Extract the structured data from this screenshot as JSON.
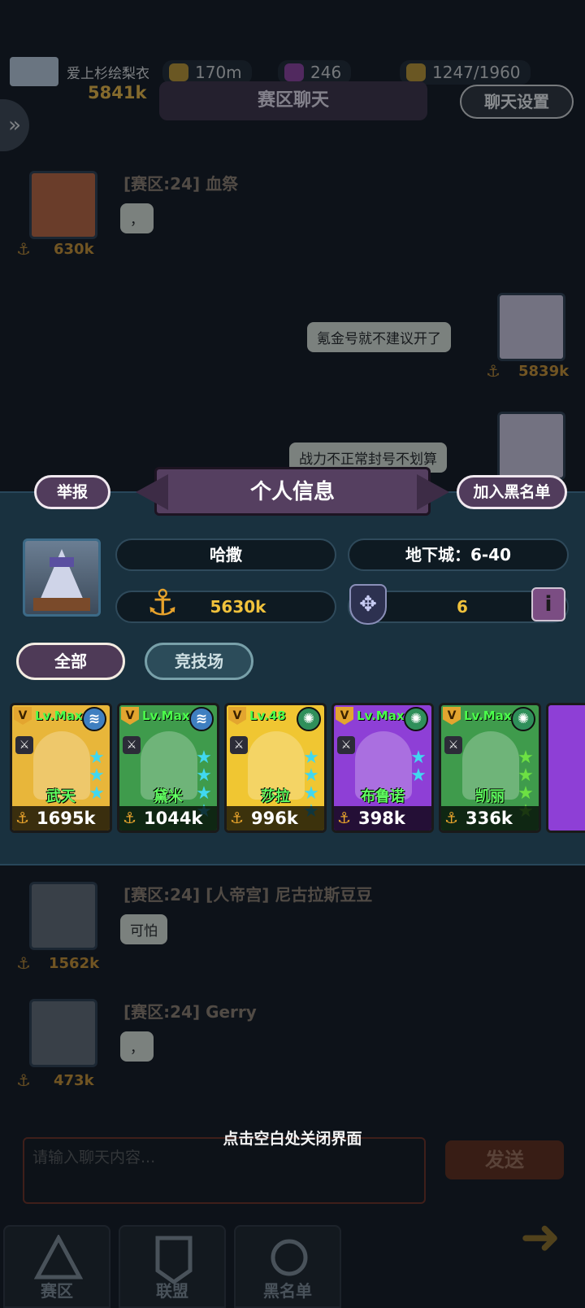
{
  "topbar": {
    "player_name": "爱上杉绘梨衣",
    "player_power": "5841k",
    "gold": "170m",
    "gems": "246",
    "energy": "1247/1960"
  },
  "chat": {
    "title": "赛区聊天",
    "settings_label": "聊天设置",
    "messages_top": [
      {
        "sender": "[赛区:24] 血祭",
        "text": "，",
        "power": "630k"
      },
      {
        "text": "氪金号就不建议开了",
        "power": "5839k"
      },
      {
        "text": "战力不正常封号不划算"
      }
    ],
    "messages_bottom": [
      {
        "sender": "[赛区:24] [人帝宫] 尼古拉斯豆豆",
        "text": "可怕",
        "power": "1562k"
      },
      {
        "sender": "[赛区:24] Gerry",
        "text": "，",
        "power": "473k"
      }
    ],
    "input_placeholder": "请输入聊天内容...",
    "send_label": "发送",
    "close_hint": "点击空白处关闭界面"
  },
  "bottom_tabs": [
    {
      "label": "赛区"
    },
    {
      "label": "联盟"
    },
    {
      "label": "黑名单"
    }
  ],
  "info_panel": {
    "title": "个人信息",
    "report_label": "举报",
    "blacklist_label": "加入黑名单",
    "player_name": "哈撒",
    "dungeon": "地下城：6-40",
    "power": "5630k",
    "rank": "6",
    "tabs": [
      {
        "label": "全部",
        "active": true
      },
      {
        "label": "竞技场",
        "active": false
      }
    ],
    "heroes": [
      {
        "name": "武天",
        "level": "Lv.Max",
        "power": "1695k",
        "stars": 3,
        "element": "water",
        "bg": "#e8b63a",
        "star_color": "#41d8f0"
      },
      {
        "name": "黛米",
        "level": "Lv.Max",
        "power": "1044k",
        "stars": 4,
        "element": "water",
        "bg": "#3f9b4c",
        "star_color": "#41d8f0"
      },
      {
        "name": "莎拉",
        "level": "Lv.48",
        "power": "996k",
        "stars": 4,
        "element": "wind",
        "bg": "#f0c632",
        "star_color": "#41d8f0"
      },
      {
        "name": "布鲁诺",
        "level": "Lv.Max",
        "power": "398k",
        "stars": 2,
        "element": "wind",
        "bg": "#8e3fd6",
        "star_color": "#41d8f0"
      },
      {
        "name": "凯丽",
        "level": "Lv.Max",
        "power": "336k",
        "stars": 4,
        "element": "wind",
        "bg": "#3f9b4c",
        "star_color": "#6de043"
      }
    ]
  },
  "colors": {
    "panel_bg": "#19313f",
    "accent_purple": "#513c5c",
    "power_gold": "#f0c23c"
  }
}
